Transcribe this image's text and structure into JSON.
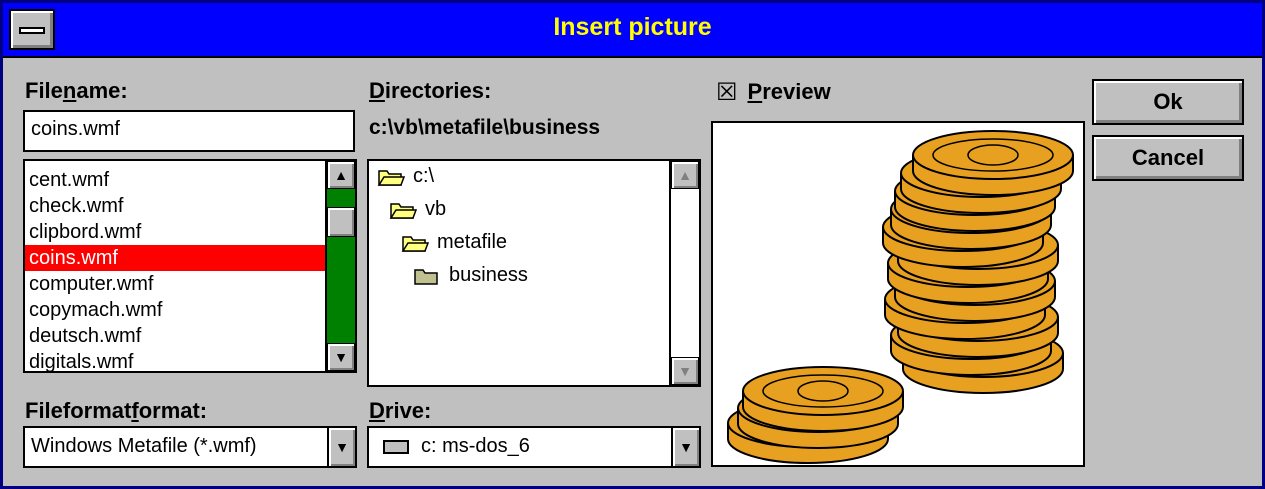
{
  "dialog": {
    "title": "Insert picture"
  },
  "filename": {
    "label_pre": "File",
    "label_u": "n",
    "label_post": "ame:",
    "value": "coins.wmf",
    "files": [
      "cent.wmf",
      "check.wmf",
      "clipbord.wmf",
      "coins.wmf",
      "computer.wmf",
      "copymach.wmf",
      "deutsch.wmf",
      "digitals.wmf"
    ],
    "selected_index": 3
  },
  "directories": {
    "label_u": "D",
    "label_post": "irectories:",
    "path": "c:\\vb\\metafile\\business",
    "tree": [
      "c:\\",
      "vb",
      "metafile",
      "business"
    ]
  },
  "format": {
    "label_pre": "Fileformat",
    "label_u": "f",
    "label_post": "ormat:",
    "value": "Windows Metafile (*.wmf)"
  },
  "drive": {
    "label_u": "D",
    "label_post": "rive:",
    "value": "c: ms-dos_6"
  },
  "preview": {
    "checkbox_symbol": "☒",
    "label_u": "P",
    "label_post": "review",
    "checked": true
  },
  "buttons": {
    "ok": "Ok",
    "cancel": "Cancel"
  },
  "icons": {
    "scroll_up": "up-arrow-icon",
    "scroll_down": "down-arrow-icon",
    "folder": "folder-icon",
    "drive": "drive-icon"
  },
  "colors": {
    "titlebar": "#0000ff",
    "title_text": "#ffff00",
    "selection": "#ff0000",
    "scrollbar_track": "#008000",
    "face": "#c0c0c0",
    "coin": "#e8a020"
  }
}
